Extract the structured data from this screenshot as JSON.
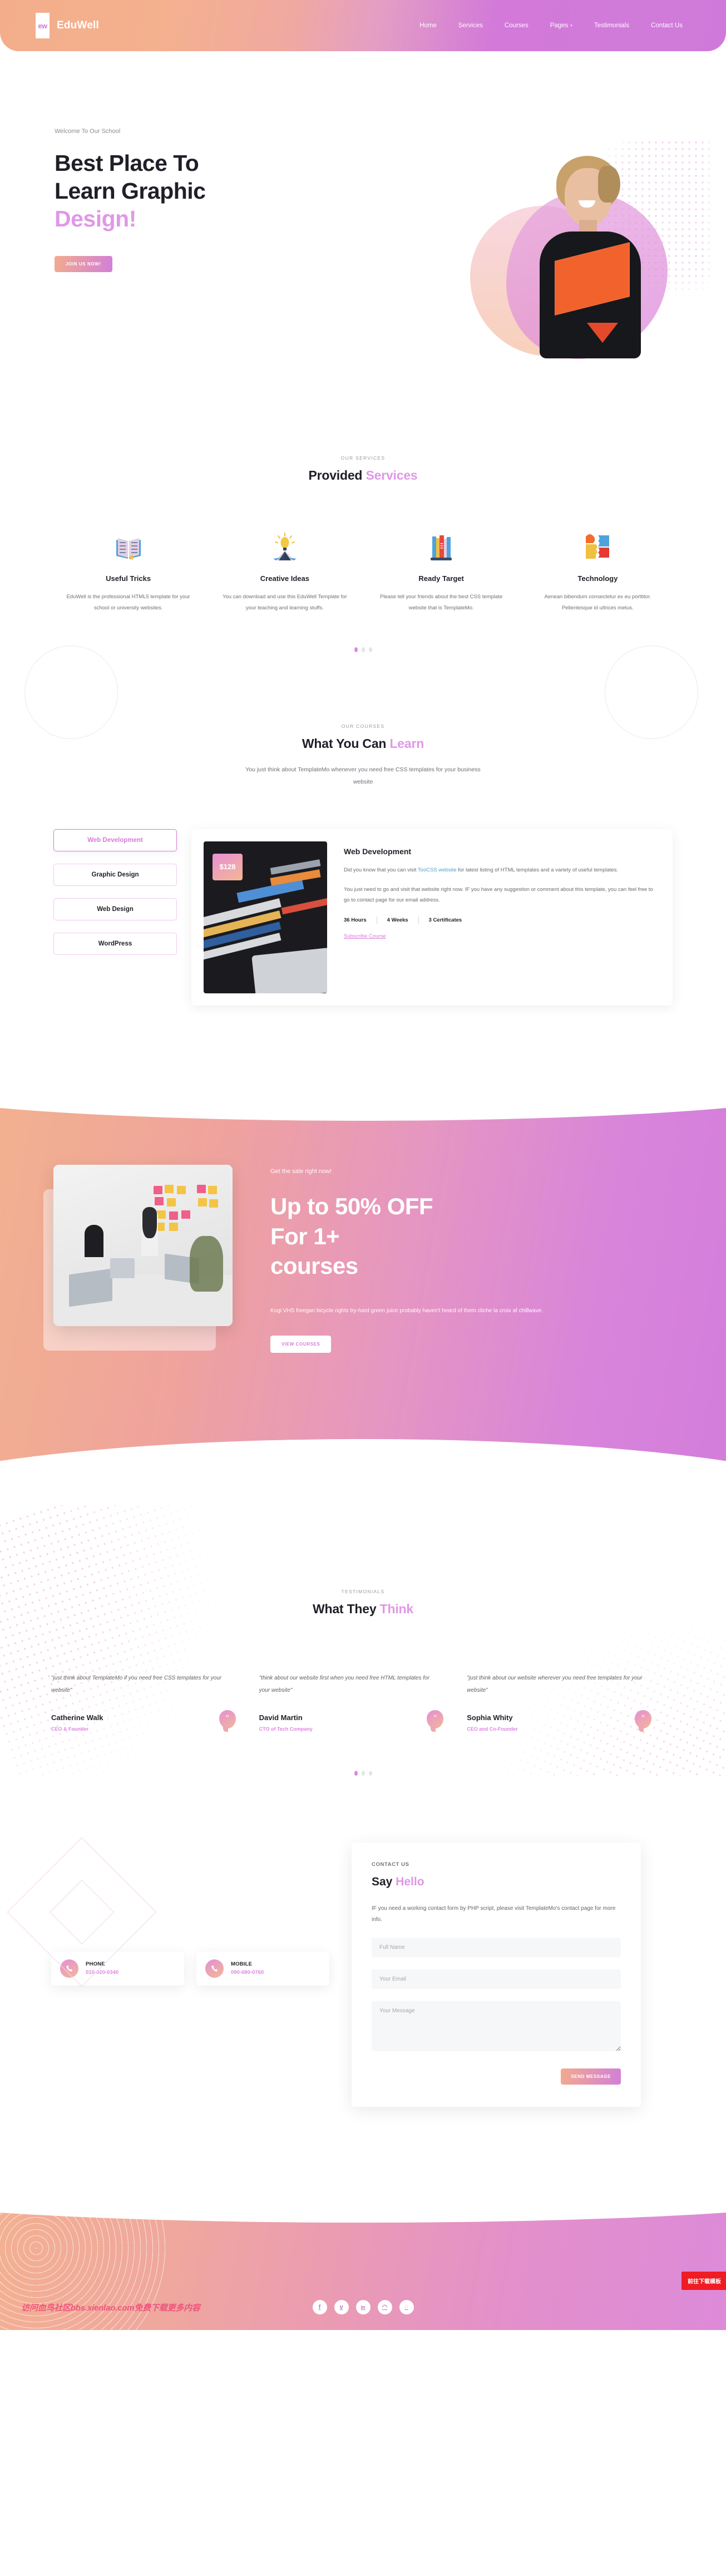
{
  "header": {
    "brand_mark": "ew",
    "brand_name": "EduWell",
    "nav": [
      {
        "label": "Home",
        "caret": ""
      },
      {
        "label": "Services",
        "caret": ""
      },
      {
        "label": "Courses",
        "caret": ""
      },
      {
        "label": "Pages",
        "caret": "▾"
      },
      {
        "label": "Testimonials",
        "caret": ""
      },
      {
        "label": "Contact Us",
        "caret": ""
      }
    ]
  },
  "hero": {
    "kicker": "Welcome To Our School",
    "title_line1": "Best Place To",
    "title_line2": "Learn Graphic",
    "title_accent": "Design!",
    "button": "JOIN US NOW!"
  },
  "services": {
    "kicker": "OUR SERVICES",
    "title_main": "Provided ",
    "title_accent": "Services",
    "items": [
      {
        "icon": "open-book-icon",
        "name": "Useful Tricks",
        "desc": "EduWell is the professional HTML5 template for your school or university websites."
      },
      {
        "icon": "idea-bulb-book-icon",
        "name": "Creative Ideas",
        "desc": "You can download and use this EduWell Template for your teaching and learning stuffs."
      },
      {
        "icon": "book-stack-icon",
        "name": "Ready Target",
        "desc": "Please tell your friends about the best CSS template website that is TemplateMo."
      },
      {
        "icon": "puzzle-pieces-icon",
        "name": "Technology",
        "desc": "Aenean bibendum consectetur ex eu porttitor. Pellentesque id ultrices metus."
      }
    ],
    "pagination": [
      "active",
      "",
      ""
    ]
  },
  "courses": {
    "kicker": "OUR COURSES",
    "title_main": "What You Can ",
    "title_accent": "Learn",
    "subtitle": "You just think about TemplateMo whenever you need free CSS templates for your business website",
    "tabs": [
      {
        "label": "Web Development",
        "active": true
      },
      {
        "label": "Graphic Design",
        "active": false
      },
      {
        "label": "Web Design",
        "active": false
      },
      {
        "label": "WordPress",
        "active": false
      }
    ],
    "card": {
      "price": "$128",
      "title": "Web Development",
      "para1_before": "Did you know that you can visit ",
      "para1_link": "TooCSS website",
      "para1_after": " for latest listing of HTML templates and a variety of useful templates.",
      "para2": "You just need to go and visit that website right now. IF you have any suggestion or comment about this template, you can feel free to go to contact page for our email address.",
      "meta": [
        "36 Hours",
        "4 Weeks",
        "3 Certificates"
      ],
      "cta": "Subscribe Course"
    }
  },
  "sale": {
    "kicker": "Get the sale right now!",
    "title_line1": "Up to 50% OFF",
    "title_line2": "For 1+",
    "title_line3": "courses",
    "desc": "Kogi VHS freegan bicycle rights try-hard green juice probably haven't heard of them cliche la croix af chillwave.",
    "button": "VIEW COURSES"
  },
  "testimonials": {
    "kicker": "TESTIMONIALS",
    "title_main": "What They ",
    "title_accent": "Think",
    "items": [
      {
        "quote": "\"just think about TemplateMo if you need free CSS templates for your website\"",
        "name": "Catherine Walk",
        "role": "CEO & Founder",
        "mark": "”"
      },
      {
        "quote": "\"think about our website first when you need free HTML templates for your website\"",
        "name": "David Martin",
        "role": "CTO of Tech Company",
        "mark": "”"
      },
      {
        "quote": "\"just think about our website wherever you need free templates for your website\"",
        "name": "Sophia Whity",
        "role": "CEO and Co-Founder",
        "mark": "”"
      }
    ],
    "pagination": [
      "active",
      "",
      ""
    ]
  },
  "contact": {
    "kicker": "CONTACT US",
    "title_main": "Say ",
    "title_accent": "Hello",
    "desc": "IF you need a working contact form by PHP script, please visit TemplateMo's contact page for more info.",
    "fields": {
      "name_placeholder": "Full Name",
      "email_placeholder": "Your Email",
      "message_placeholder": "Your Message"
    },
    "submit": "SEND MESSAGE",
    "info": [
      {
        "icon": "phone-icon",
        "label": "PHONE",
        "value": "010-020-0340"
      },
      {
        "icon": "phone-icon",
        "label": "MOBILE",
        "value": "090-080-0760"
      }
    ]
  },
  "footer": {
    "socials": [
      {
        "icon": "facebook-icon",
        "glyph": "f"
      },
      {
        "icon": "twitter-icon",
        "glyph": "ᴠ"
      },
      {
        "icon": "linkedin-icon",
        "glyph": "in"
      },
      {
        "icon": "rss-icon",
        "glyph": "◠"
      },
      {
        "icon": "dribbble-icon",
        "glyph": "◌"
      }
    ],
    "watermark": "访问血鸟社区bbs.xienlao.com免费下载更多内容",
    "download_button": "前往下载模板"
  }
}
